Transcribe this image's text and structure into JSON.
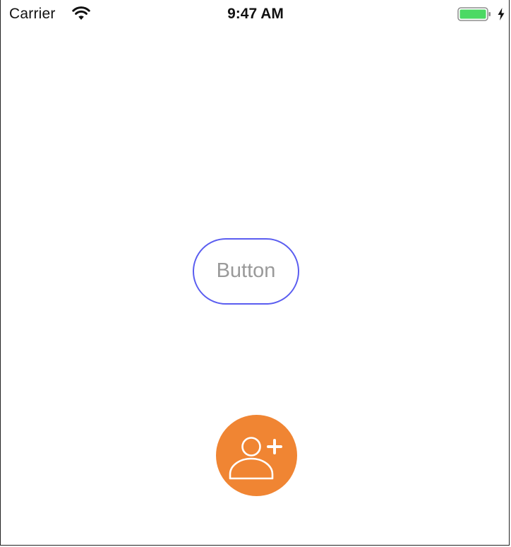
{
  "status_bar": {
    "carrier": "Carrier",
    "time": "9:47 AM",
    "wifi_icon": "wifi-icon",
    "battery_icon": "battery-icon",
    "charging_icon": "charging-bolt-icon",
    "battery_color": "#4cd964"
  },
  "main": {
    "button_label": "Button",
    "button_border_color": "#5a5df0",
    "button_text_color": "#9a9a9a",
    "fab_icon": "add-user-icon",
    "fab_color": "#f08533"
  }
}
